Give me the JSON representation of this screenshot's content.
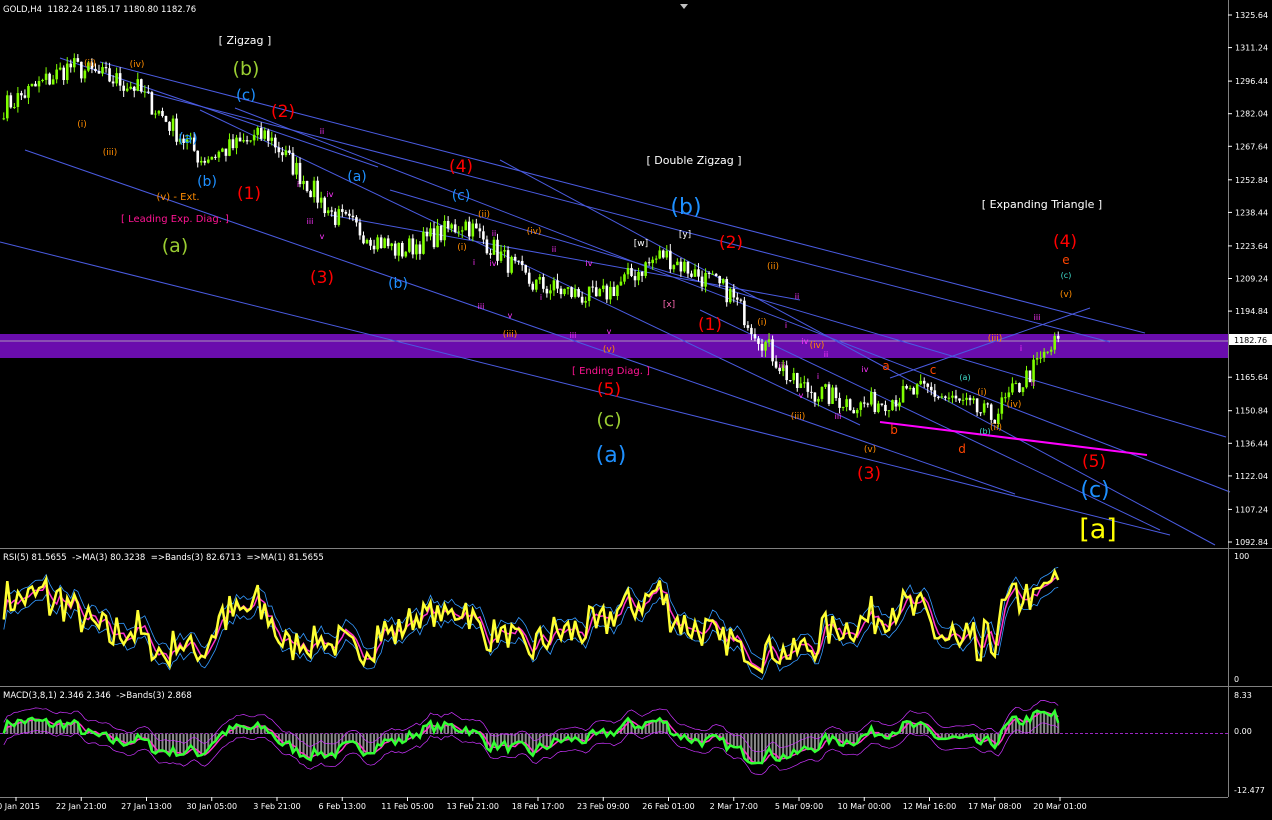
{
  "header": {
    "symbol": "GOLD,H4",
    "ohlc": "1182.24 1185.17 1180.80 1182.76",
    "rsi_info": "RSI(5) 81.5655  ->MA(3) 80.3238  =>Bands(3) 82.6713  =>MA(1) 81.5655",
    "macd_info": "MACD(3,8,1) 2.346 2.346  ->Bands(3) 2.868"
  },
  "colors": {
    "background": "#000000",
    "bull_candle": "#7fff00",
    "bear_candle": "#ffffff",
    "trendline": "#4a5be0",
    "zone": "#6a0dad",
    "pink_line": "#ff00ff",
    "rsi_line": "#ffff33",
    "ma_line": "#ff33cc",
    "band_line": "#3399ff",
    "macd_line": "#33ff33",
    "macd_signal": "#cc33ff",
    "histogram": "#8a8a8a"
  },
  "price_axis": {
    "ticks": [
      "1325.64",
      "1311.24",
      "1296.44",
      "1282.04",
      "1267.64",
      "1252.84",
      "1238.44",
      "1223.64",
      "1209.24",
      "1194.84",
      "1165.64",
      "1150.84",
      "1136.44",
      "1122.04",
      "1107.24",
      "1092.84"
    ],
    "current": "1182.76",
    "hidden": "1180.04"
  },
  "time_axis": [
    "20 Jan 2015",
    "22 Jan 21:00",
    "27 Jan 13:00",
    "30 Jan 05:00",
    "3 Feb 21:00",
    "6 Feb 13:00",
    "11 Feb 05:00",
    "13 Feb 21:00",
    "18 Feb 17:00",
    "23 Feb 09:00",
    "26 Feb 01:00",
    "2 Mar 17:00",
    "5 Mar 09:00",
    "10 Mar 00:00",
    "12 Mar 16:00",
    "17 Mar 08:00",
    "20 Mar 01:00"
  ],
  "rsi_axis": {
    "top": "100",
    "bottom": "0"
  },
  "macd_axis": {
    "top": "8.33",
    "mid": "0.00",
    "bottom": "-12.477"
  },
  "chart_data": [
    {
      "type": "candlestick",
      "title": "GOLD,H4",
      "x": [
        "20 Jan 2015",
        "22 Jan 21:00",
        "27 Jan 13:00",
        "30 Jan 05:00",
        "3 Feb 21:00",
        "6 Feb 13:00",
        "11 Feb 05:00",
        "13 Feb 21:00",
        "18 Feb 17:00",
        "23 Feb 09:00",
        "26 Feb 01:00",
        "2 Mar 17:00",
        "5 Mar 09:00",
        "10 Mar 00:00",
        "12 Mar 16:00",
        "17 Mar 08:00",
        "20 Mar 01:00"
      ],
      "close_path": [
        1285,
        1303,
        1294,
        1262,
        1273,
        1237,
        1221,
        1234,
        1207,
        1200,
        1220,
        1203,
        1162,
        1153,
        1160,
        1148,
        1182
      ],
      "ylim": [
        1090,
        1330
      ],
      "zone": {
        "from": 1176,
        "to": 1188
      }
    },
    {
      "type": "line",
      "title": "RSI(5)",
      "series_names": [
        "RSI(5)",
        "MA(3)",
        "Bands(3)"
      ],
      "ylim": [
        0,
        100
      ],
      "last_value": 81.5655
    },
    {
      "type": "line",
      "title": "MACD(3,8,1)",
      "series_names": [
        "MACD",
        "Signal",
        "Bands(3)"
      ],
      "ylim": [
        -12.477,
        8.33
      ],
      "last_value": 2.346
    }
  ],
  "annotations": [
    {
      "text": "[ Zigzag ]",
      "color": "#ffffff",
      "size": 11,
      "x": 245,
      "y": 44
    },
    {
      "text": "(b)",
      "color": "#9acd32",
      "size": 19,
      "x": 246,
      "y": 75
    },
    {
      "text": "(c)",
      "color": "#1e90ff",
      "size": 15,
      "x": 246,
      "y": 100
    },
    {
      "text": "(2)",
      "color": "#ff0000",
      "size": 17,
      "x": 283,
      "y": 117
    },
    {
      "text": "(a)",
      "color": "#1e90ff",
      "size": 14,
      "x": 188,
      "y": 143
    },
    {
      "text": "(b)",
      "color": "#1e90ff",
      "size": 14,
      "x": 207,
      "y": 186
    },
    {
      "text": "(1)",
      "color": "#ff0000",
      "size": 17,
      "x": 249,
      "y": 199
    },
    {
      "text": "(v) - Ext.",
      "color": "#ff8c00",
      "size": 10,
      "x": 178,
      "y": 200
    },
    {
      "text": "[ Leading Exp. Diag. ]",
      "color": "#ff1493",
      "size": 10,
      "x": 175,
      "y": 222
    },
    {
      "text": "(a)",
      "color": "#9acd32",
      "size": 19,
      "x": 175,
      "y": 252
    },
    {
      "text": "(ii)",
      "color": "#ff8c00",
      "size": 9,
      "x": 90,
      "y": 66
    },
    {
      "text": "(iv)",
      "color": "#ff8c00",
      "size": 9,
      "x": 137,
      "y": 67
    },
    {
      "text": "(i)",
      "color": "#ff8c00",
      "size": 9,
      "x": 82,
      "y": 127
    },
    {
      "text": "(iii)",
      "color": "#ff8c00",
      "size": 9,
      "x": 110,
      "y": 155
    },
    {
      "text": "(3)",
      "color": "#ff0000",
      "size": 17,
      "x": 322,
      "y": 283
    },
    {
      "text": "(a)",
      "color": "#1e90ff",
      "size": 14,
      "x": 357,
      "y": 181
    },
    {
      "text": "(b)",
      "color": "#1e90ff",
      "size": 14,
      "x": 398,
      "y": 288
    },
    {
      "text": "(4)",
      "color": "#ff0000",
      "size": 17,
      "x": 461,
      "y": 172
    },
    {
      "text": "(c)",
      "color": "#1e90ff",
      "size": 14,
      "x": 461,
      "y": 200
    },
    {
      "text": "[ Double Zigzag ]",
      "color": "#ffffff",
      "size": 11,
      "x": 694,
      "y": 164
    },
    {
      "text": "(b)",
      "color": "#1e90ff",
      "size": 22,
      "x": 686,
      "y": 214
    },
    {
      "text": "[y]",
      "color": "#ffffff",
      "size": 9,
      "x": 685,
      "y": 237
    },
    {
      "text": "[w]",
      "color": "#ffffff",
      "size": 9,
      "x": 641,
      "y": 246
    },
    {
      "text": "[x]",
      "color": "#ff69b4",
      "size": 9,
      "x": 669,
      "y": 307
    },
    {
      "text": "(2)",
      "color": "#ff0000",
      "size": 17,
      "x": 731,
      "y": 248
    },
    {
      "text": "(1)",
      "color": "#ff0000",
      "size": 17,
      "x": 710,
      "y": 330
    },
    {
      "text": "(5)",
      "color": "#ff0000",
      "size": 17,
      "x": 609,
      "y": 395
    },
    {
      "text": "[ Ending Diag. ]",
      "color": "#ff1493",
      "size": 10,
      "x": 611,
      "y": 374
    },
    {
      "text": "(c)",
      "color": "#9acd32",
      "size": 19,
      "x": 609,
      "y": 426
    },
    {
      "text": "(a)",
      "color": "#1e90ff",
      "size": 22,
      "x": 611,
      "y": 462
    },
    {
      "text": "(iii)",
      "color": "#ff8c00",
      "size": 9,
      "x": 510,
      "y": 337
    },
    {
      "text": "(v)",
      "color": "#ff8c00",
      "size": 9,
      "x": 609,
      "y": 352
    },
    {
      "text": "(ii)",
      "color": "#ff8c00",
      "size": 9,
      "x": 484,
      "y": 217
    },
    {
      "text": "(iv)",
      "color": "#ff8c00",
      "size": 9,
      "x": 534,
      "y": 234
    },
    {
      "text": "(i)",
      "color": "#ff8c00",
      "size": 9,
      "x": 462,
      "y": 250
    },
    {
      "text": "(ii)",
      "color": "#ff8c00",
      "size": 9,
      "x": 773,
      "y": 269
    },
    {
      "text": "(i)",
      "color": "#ff8c00",
      "size": 9,
      "x": 762,
      "y": 325
    },
    {
      "text": "(iv)",
      "color": "#ff8c00",
      "size": 9,
      "x": 817,
      "y": 348
    },
    {
      "text": "(iii)",
      "color": "#ff8c00",
      "size": 9,
      "x": 798,
      "y": 419
    },
    {
      "text": "(v)",
      "color": "#ff8c00",
      "size": 9,
      "x": 870,
      "y": 452
    },
    {
      "text": "(3)",
      "color": "#ff0000",
      "size": 17,
      "x": 869,
      "y": 479
    },
    {
      "text": "[ Expanding Triangle ]",
      "color": "#ffffff",
      "size": 11,
      "x": 1042,
      "y": 208
    },
    {
      "text": "(4)",
      "color": "#ff0000",
      "size": 17,
      "x": 1065,
      "y": 247
    },
    {
      "text": "e",
      "color": "#ff4500",
      "size": 12,
      "x": 1066,
      "y": 264
    },
    {
      "text": "(c)",
      "color": "#40e0d0",
      "size": 8,
      "x": 1066,
      "y": 278
    },
    {
      "text": "(v)",
      "color": "#ff8c00",
      "size": 9,
      "x": 1066,
      "y": 297
    },
    {
      "text": "a",
      "color": "#ff4500",
      "size": 12,
      "x": 886,
      "y": 370
    },
    {
      "text": "c",
      "color": "#ff4500",
      "size": 12,
      "x": 933,
      "y": 374
    },
    {
      "text": "b",
      "color": "#ff4500",
      "size": 12,
      "x": 894,
      "y": 434
    },
    {
      "text": "d",
      "color": "#ff4500",
      "size": 12,
      "x": 962,
      "y": 453
    },
    {
      "text": "(a)",
      "color": "#40e0d0",
      "size": 8,
      "x": 965,
      "y": 380
    },
    {
      "text": "(b)",
      "color": "#40e0d0",
      "size": 8,
      "x": 985,
      "y": 434
    },
    {
      "text": "(iii)",
      "color": "#ff8c00",
      "size": 9,
      "x": 995,
      "y": 341
    },
    {
      "text": "(i)",
      "color": "#ff8c00",
      "size": 9,
      "x": 982,
      "y": 395
    },
    {
      "text": "(iv)",
      "color": "#ff8c00",
      "size": 9,
      "x": 1014,
      "y": 407
    },
    {
      "text": "(ii)",
      "color": "#ff8c00",
      "size": 9,
      "x": 996,
      "y": 430
    },
    {
      "text": "(5)",
      "color": "#ff0000",
      "size": 17,
      "x": 1094,
      "y": 467
    },
    {
      "text": "(c)",
      "color": "#1e90ff",
      "size": 22,
      "x": 1095,
      "y": 497
    },
    {
      "text": "[a]",
      "color": "#ffff00",
      "size": 27,
      "x": 1098,
      "y": 538
    }
  ],
  "minor_labels": [
    {
      "text": "ii",
      "x": 322,
      "y": 134
    },
    {
      "text": "i",
      "x": 298,
      "y": 187
    },
    {
      "text": "iii",
      "x": 310,
      "y": 224
    },
    {
      "text": "iv",
      "x": 330,
      "y": 197
    },
    {
      "text": "v",
      "x": 322,
      "y": 239
    },
    {
      "text": "ii",
      "x": 494,
      "y": 236
    },
    {
      "text": "i",
      "x": 474,
      "y": 265
    },
    {
      "text": "iv",
      "x": 493,
      "y": 266
    },
    {
      "text": "iii",
      "x": 481,
      "y": 309
    },
    {
      "text": "v",
      "x": 510,
      "y": 318
    },
    {
      "text": "ii",
      "x": 554,
      "y": 252
    },
    {
      "text": "i",
      "x": 541,
      "y": 300
    },
    {
      "text": "iv",
      "x": 589,
      "y": 266
    },
    {
      "text": "iii",
      "x": 573,
      "y": 338
    },
    {
      "text": "v",
      "x": 609,
      "y": 334
    },
    {
      "text": "ii",
      "x": 797,
      "y": 299
    },
    {
      "text": "i",
      "x": 786,
      "y": 328
    },
    {
      "text": "iv",
      "x": 805,
      "y": 344
    },
    {
      "text": "iii",
      "x": 782,
      "y": 368
    },
    {
      "text": "v",
      "x": 801,
      "y": 398
    },
    {
      "text": "ii",
      "x": 826,
      "y": 357
    },
    {
      "text": "i",
      "x": 818,
      "y": 379
    },
    {
      "text": "iv",
      "x": 865,
      "y": 372
    },
    {
      "text": "iii",
      "x": 838,
      "y": 419
    },
    {
      "text": "iii",
      "x": 1037,
      "y": 320
    },
    {
      "text": "i",
      "x": 1021,
      "y": 351
    },
    {
      "text": "ii",
      "x": 1033,
      "y": 386
    }
  ],
  "trendlines": [
    {
      "x1": 60,
      "y1": 58,
      "x2": 378,
      "y2": 167
    },
    {
      "x1": 100,
      "y1": 62,
      "x2": 1145,
      "y2": 333
    },
    {
      "x1": 130,
      "y1": 88,
      "x2": 1110,
      "y2": 342
    },
    {
      "x1": 25,
      "y1": 150,
      "x2": 1015,
      "y2": 494
    },
    {
      "x1": 0,
      "y1": 242,
      "x2": 1170,
      "y2": 535
    },
    {
      "x1": 235,
      "y1": 108,
      "x2": 1230,
      "y2": 492
    },
    {
      "x1": 390,
      "y1": 190,
      "x2": 1226,
      "y2": 437
    },
    {
      "x1": 500,
      "y1": 160,
      "x2": 1215,
      "y2": 545
    },
    {
      "x1": 200,
      "y1": 110,
      "x2": 860,
      "y2": 425
    },
    {
      "x1": 330,
      "y1": 215,
      "x2": 800,
      "y2": 300
    },
    {
      "x1": 890,
      "y1": 378,
      "x2": 1090,
      "y2": 308
    },
    {
      "x1": 700,
      "y1": 310,
      "x2": 1160,
      "y2": 530
    }
  ]
}
